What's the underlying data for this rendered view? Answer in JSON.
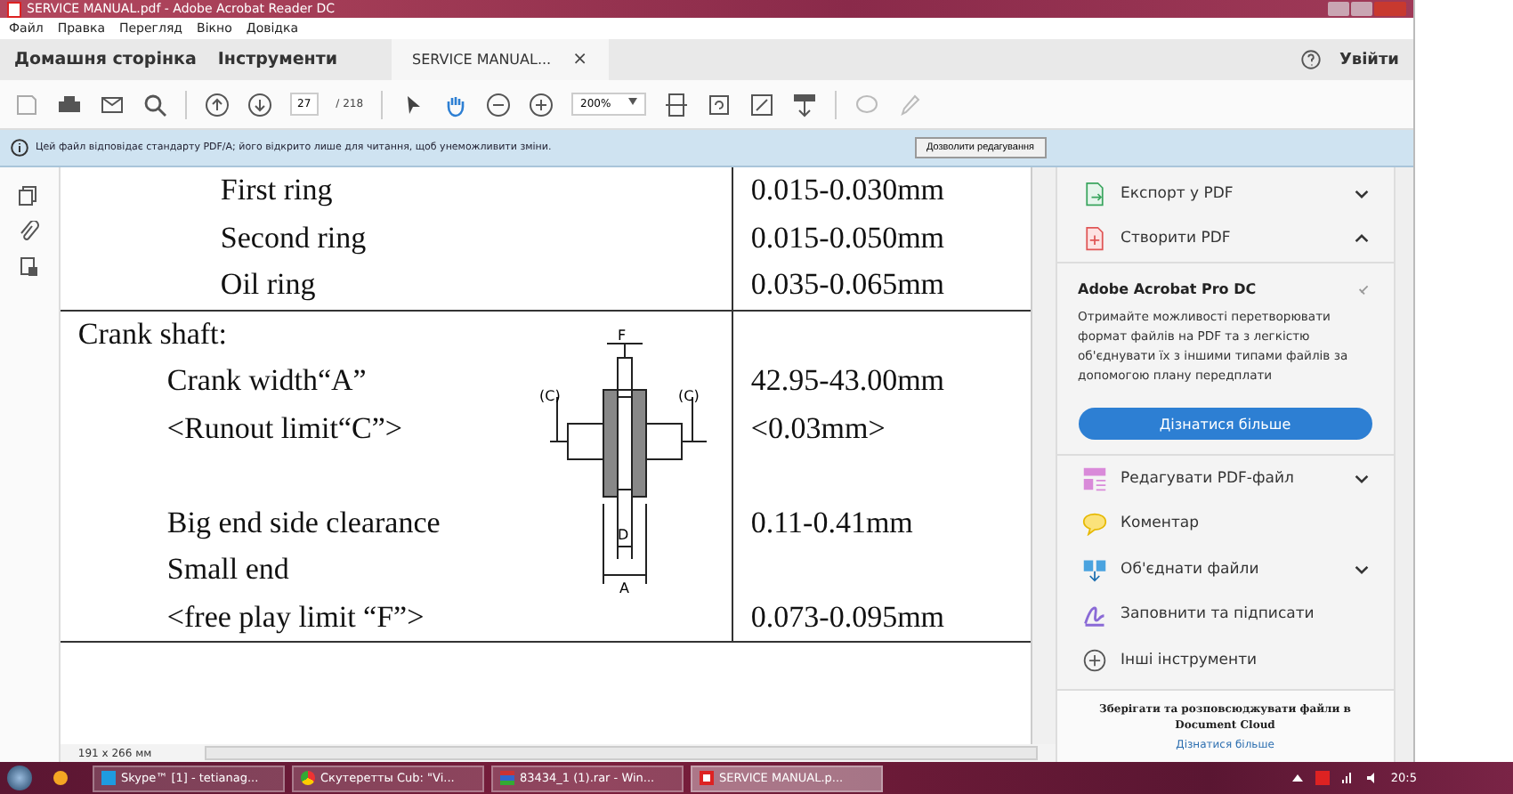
{
  "window": {
    "title": "SERVICE MANUAL.pdf - Adobe Acrobat Reader DC"
  },
  "menu": [
    "Файл",
    "Правка",
    "Перегляд",
    "Вікно",
    "Довідка"
  ],
  "tabs": [
    {
      "label": "Домашня сторінка",
      "selected": false,
      "closable": false
    },
    {
      "label": "Інструменти",
      "selected": false,
      "closable": false
    },
    {
      "label": "SERVICE MANUAL...",
      "selected": true,
      "closable": true
    }
  ],
  "close_glyph": "×",
  "sign_in": "Увійти",
  "toolbar": {
    "page_number": "27",
    "page_total": "/ 218",
    "zoom": "200%"
  },
  "info_bar": {
    "text": "Цей файл відповідає стандарту PDF/A; його відкрито лише для читання, щоб унеможливити зміни.",
    "button": "Дозволити редагування"
  },
  "document": {
    "groups": [
      {
        "kind": "continued",
        "rows": [
          {
            "kind": "item",
            "label": "First ring",
            "value": "0.015-0.030mm"
          },
          {
            "kind": "item",
            "label": "Second ring",
            "value": "0.015-0.050mm"
          },
          {
            "kind": "item",
            "label": "Oil ring",
            "value": "0.035-0.065mm"
          }
        ]
      },
      {
        "kind": "section",
        "rows": [
          {
            "kind": "heading",
            "label": "Crank shaft:"
          },
          {
            "kind": "item",
            "label": "Crank width“A”",
            "value": "42.95-43.00mm"
          },
          {
            "kind": "item",
            "label": "<Runout limit“C”>",
            "value": "<0.03mm>"
          },
          {
            "kind": "spacer"
          },
          {
            "kind": "item",
            "label": "Big end side clearance",
            "value": "0.11-0.41mm"
          },
          {
            "kind": "item",
            "label": "Small end"
          },
          {
            "kind": "item",
            "label": "<free play limit “F”>",
            "value": "0.073-0.095mm"
          }
        ],
        "diagram_labels": {
          "top": "F",
          "left": "(C)",
          "right": "(C)",
          "middle": "D",
          "bottom": "A"
        }
      }
    ]
  },
  "status": {
    "page_size": "191 x 266 мм"
  },
  "tools": [
    {
      "kind": "export",
      "label": "Експорт у PDF",
      "expandable": true,
      "expanded": false
    },
    {
      "kind": "create",
      "label": "Створити PDF",
      "expandable": true,
      "expanded": true
    }
  ],
  "promo": {
    "title": "Adobe Acrobat Pro DC",
    "text": "Отримайте можливості перетворювати формат файлів на PDF та з легкістю об'єднувати їх з іншими типами файлів за допомогою плану передплати",
    "button": "Дізнатися більше"
  },
  "tools_more": [
    {
      "kind": "edit",
      "label": "Редагувати PDF-файл",
      "expandable": true,
      "expanded": false
    },
    {
      "kind": "comment",
      "label": "Коментар",
      "expandable": false
    },
    {
      "kind": "combine",
      "label": "Об'єднати файли",
      "expandable": true,
      "expanded": false
    },
    {
      "kind": "sign",
      "label": "Заповнити та підписати",
      "expandable": false
    },
    {
      "kind": "more",
      "label": "Інші інструменти",
      "expandable": false
    }
  ],
  "cloud": {
    "text": "Зберігати та розповсюджувати файли в Document Cloud",
    "link": "Дізнатися більше"
  },
  "taskbar": {
    "items": [
      {
        "kind": "skype",
        "label": "Skype™ [1] - tetianag...",
        "selected": false
      },
      {
        "kind": "browser",
        "label": "Скутеретты Cub: \"Vi...",
        "selected": false
      },
      {
        "kind": "archive",
        "label": "83434_1 (1).rar - Win...",
        "selected": false
      },
      {
        "kind": "pdf",
        "label": "SERVICE MANUAL.p...",
        "selected": true
      }
    ],
    "clock": "20:5"
  }
}
